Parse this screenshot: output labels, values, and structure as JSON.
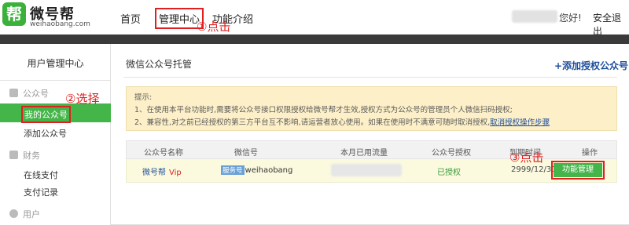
{
  "header": {
    "logo_char": "帮",
    "brand_name": "微号帮",
    "brand_domain": "weihaobang.com",
    "nav": {
      "home": "首页",
      "manage": "管理中心",
      "features": "功能介绍"
    },
    "greeting": "您好!",
    "logout": "安全退出"
  },
  "annotations": {
    "step1": "①点击",
    "step2": "②选择",
    "step3": "③点击"
  },
  "sidebar": {
    "title": "用户管理中心",
    "group_account": "公众号",
    "item_my_accounts": "我的公众号",
    "item_add_account": "添加公众号",
    "group_finance": "财务",
    "item_online_pay": "在线支付",
    "item_pay_records": "支付记录",
    "group_user": "用户"
  },
  "main": {
    "title": "微信公众号托管",
    "add_link": "+添加授权公众号",
    "notice": {
      "line1": "提示:",
      "line2": "1、在使用本平台功能时,需要将公众号接口权限授权给微号帮才生效,授权方式为公众号的管理员个人微信扫码授权;",
      "line3": "2、兼容性,对之前已经授权的第三方平台互不影响,请运营者放心使用。如果在使用时不满意可随时取消授权,",
      "line3_link": "取消授权操作步骤"
    },
    "table": {
      "headers": [
        "公众号名称",
        "微信号",
        "本月已用流量",
        "公众号授权",
        "到期时间",
        "操作"
      ],
      "row": {
        "name": "微号帮",
        "badge": "Vip",
        "wechat_tag": "服务号",
        "wechat_id": "weihaobang",
        "auth": "已授权",
        "expiry": "2999/12/31",
        "action": "功能管理"
      }
    }
  },
  "colors": {
    "accent_green": "#44b549",
    "highlight_red": "#e02020",
    "link_blue": "#1f4e9a",
    "notice_bg": "#fdf0c8"
  }
}
